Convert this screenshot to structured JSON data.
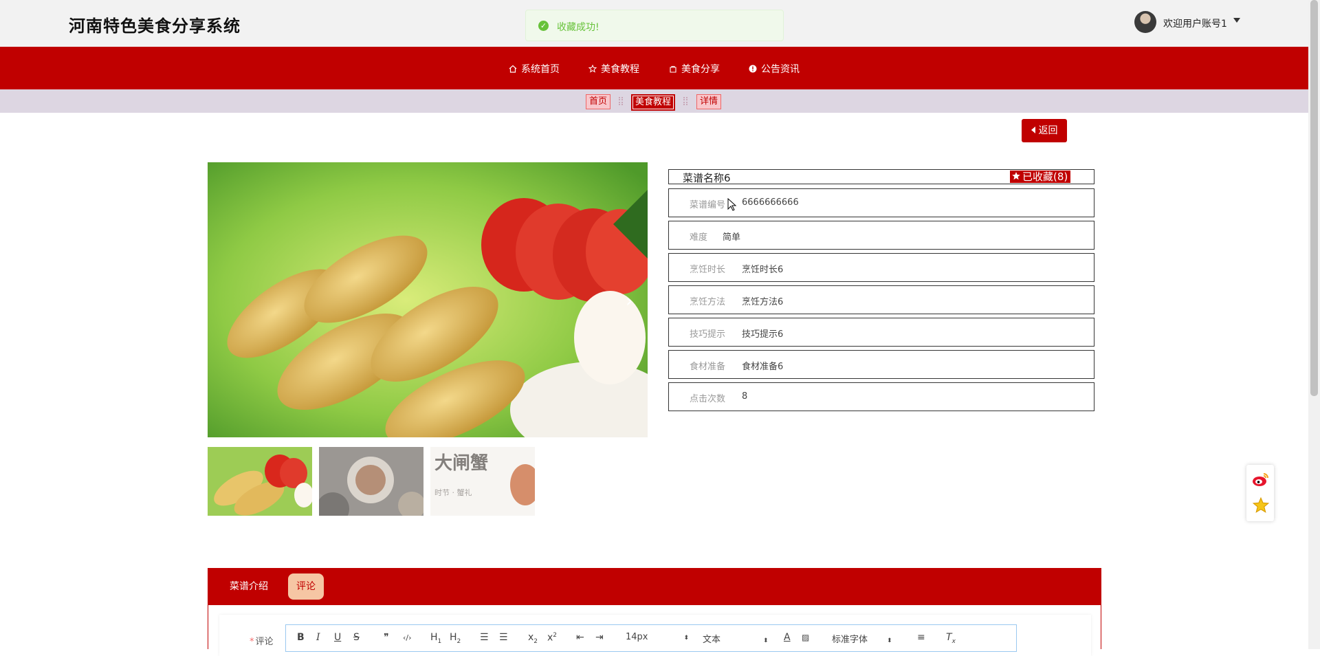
{
  "header": {
    "site_title": "河南特色美食分享系统",
    "toast": "收藏成功!",
    "user_greeting": "欢迎用户账号1"
  },
  "nav": {
    "items": [
      {
        "label": "系统首页",
        "icon": "home-icon"
      },
      {
        "label": "美食教程",
        "icon": "star-icon"
      },
      {
        "label": "美食分享",
        "icon": "bag-icon"
      },
      {
        "label": "公告资讯",
        "icon": "alert-icon"
      }
    ]
  },
  "breadcrumb": {
    "items": [
      "首页",
      "美食教程",
      "详情"
    ],
    "active_index": 1
  },
  "actions": {
    "back": "返回"
  },
  "recipe": {
    "name": "菜谱名称6",
    "favorite_label": "已收藏(8)",
    "favorite_count": 8,
    "fields": [
      {
        "label": "菜谱编号",
        "value": "6666666666"
      },
      {
        "label": "难度",
        "value": "简单"
      },
      {
        "label": "烹饪时长",
        "value": "烹饪时长6"
      },
      {
        "label": "烹饪方法",
        "value": "烹饪方法6"
      },
      {
        "label": "技巧提示",
        "value": "技巧提示6"
      },
      {
        "label": "食材准备",
        "value": "食材准备6"
      },
      {
        "label": "点击次数",
        "value": "8"
      }
    ]
  },
  "thumbnails": [
    {
      "name": "dumplings-thumb"
    },
    {
      "name": "dishes-thumb"
    },
    {
      "name": "crab-thumb",
      "text": "大闸蟹"
    }
  ],
  "tabs": {
    "items": [
      "菜谱介绍",
      "评论"
    ],
    "active_index": 1
  },
  "comment": {
    "label": "评论",
    "required_mark": "*",
    "toolbar": {
      "font_size": "14px",
      "paragraph": "文本",
      "font_family": "标准字体",
      "buttons": [
        "B",
        "I",
        "U",
        "S",
        "❞",
        "‹/›",
        "H1",
        "H2",
        "ol",
        "ul",
        "x₂",
        "x²",
        "outdent",
        "indent",
        "A",
        "bg",
        "align",
        "clear"
      ]
    }
  },
  "colors": {
    "primary": "#c00000",
    "toast_bg": "#f0f9eb",
    "toast_text": "#67c23a",
    "breadcrumb_bg": "#ddd6e2"
  }
}
